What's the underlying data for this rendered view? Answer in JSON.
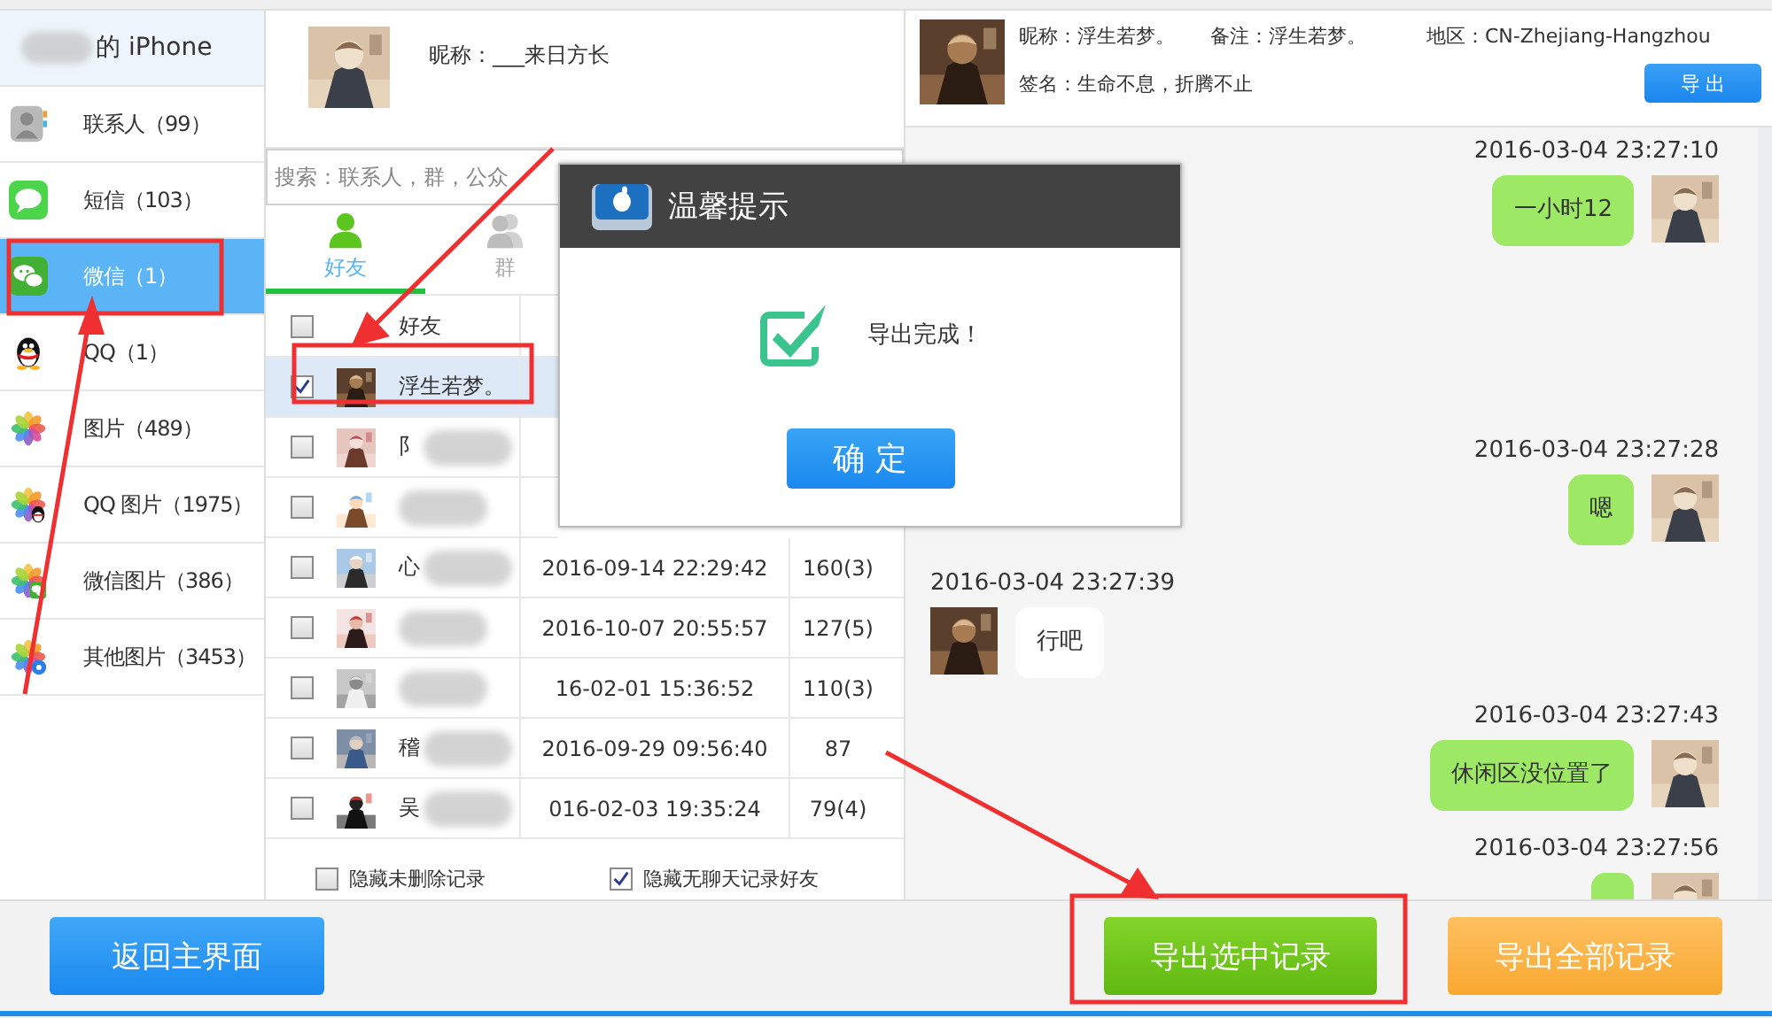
{
  "device": {
    "name": "的 iPhone"
  },
  "sidebar": {
    "items": [
      {
        "kind": "contacts",
        "label": "联系人（99）",
        "selected": false
      },
      {
        "kind": "sms",
        "label": "短信（103）",
        "selected": false
      },
      {
        "kind": "wechat",
        "label": "微信（1）",
        "selected": true
      },
      {
        "kind": "qq",
        "label": "QQ（1）",
        "selected": false
      },
      {
        "kind": "photos",
        "label": "图片（489）",
        "selected": false
      },
      {
        "kind": "qq_photos",
        "label": "QQ 图片（1975）",
        "selected": false
      },
      {
        "kind": "wechat_photos",
        "label": "微信图片（386）",
        "selected": false
      },
      {
        "kind": "other_photos",
        "label": "其他图片（3453）",
        "selected": false
      }
    ]
  },
  "account": {
    "nickname": "昵称：___来日方长"
  },
  "search": {
    "placeholder": "搜索：联系人，群，公众"
  },
  "tabs": [
    {
      "kind": "friends",
      "label": "好友",
      "selected": true
    },
    {
      "kind": "groups",
      "label": "群",
      "selected": false
    }
  ],
  "table": {
    "header": {
      "checked": false,
      "column": "好友"
    },
    "rows": [
      {
        "name": "浮生若梦。",
        "blurred": false,
        "checked": true,
        "selected": true
      },
      {
        "name": "阝",
        "blurred": true,
        "checked": false,
        "selected": false
      },
      {
        "name": "",
        "blurred": true,
        "checked": false,
        "selected": false
      },
      {
        "name": "心",
        "blurred": true,
        "date": "2016-09-14 22:29:42",
        "count": "160(3)",
        "checked": false,
        "selected": false
      },
      {
        "name": "",
        "blurred": true,
        "date": "2016-10-07 20:55:57",
        "count": "127(5)",
        "checked": false,
        "selected": false
      },
      {
        "name": "",
        "blurred": true,
        "date": "16-02-01 15:36:52",
        "count": "110(3)",
        "checked": false,
        "selected": false
      },
      {
        "name": "稽",
        "blurred": true,
        "date": "2016-09-29 09:56:40",
        "count": "87",
        "checked": false,
        "selected": false
      },
      {
        "name": "吴",
        "blurred": true,
        "date": "016-02-03 19:35:24",
        "count": "79(4)",
        "checked": false,
        "selected": false
      }
    ]
  },
  "filters": [
    {
      "label": "隐藏未删除记录",
      "checked": false
    },
    {
      "label": "隐藏无聊天记录好友",
      "checked": true
    }
  ],
  "profile": {
    "nickname": "昵称：浮生若梦。",
    "remark": "备注：浮生若梦。",
    "region": "地区：CN-Zhejiang-Hangzhou",
    "signature": "签名：生命不息，折腾不止",
    "export_button": "导 出"
  },
  "messages": [
    {
      "time": "2016-03-04 23:27:10",
      "kind": "sent",
      "text": "一小时12"
    },
    {
      "time": "2016-03-04 23:27:28",
      "kind": "sent",
      "text": "嗯"
    },
    {
      "time": "2016-03-04 23:27:39",
      "kind": "received",
      "text": "行吧"
    },
    {
      "time": "2016-03-04 23:27:43",
      "kind": "sent",
      "text": "休闲区没位置了"
    },
    {
      "time": "2016-03-04 23:27:56",
      "kind": "sent"
    }
  ],
  "dialog": {
    "title": "温馨提示",
    "message": "导出完成！",
    "button": "确 定"
  },
  "buttons": [
    {
      "kind": "primary",
      "label": "返回主界面"
    },
    {
      "kind": "success",
      "label": "导出选中记录"
    },
    {
      "kind": "warning",
      "label": "导出全部记录"
    }
  ]
}
